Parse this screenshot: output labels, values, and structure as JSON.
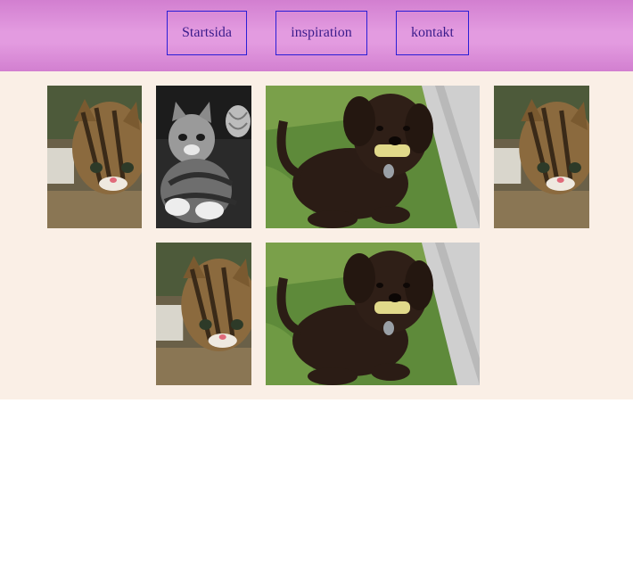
{
  "nav": {
    "items": [
      {
        "label": "Startsida"
      },
      {
        "label": "inspiration"
      },
      {
        "label": "kontakt"
      }
    ]
  },
  "colors": {
    "header_top": "#d27fd0",
    "header_mid": "#e39be0",
    "nav_border": "#2a1fd6",
    "nav_text": "#3b1c8c",
    "gallery_bg": "#faefe6"
  },
  "gallery": {
    "images": [
      {
        "subject": "tabby kitten (color)"
      },
      {
        "subject": "kitten (black and white)"
      },
      {
        "subject": "dark curly dog on grass with toy"
      },
      {
        "subject": "tabby kitten (color)"
      },
      {
        "subject": "tabby kitten (color)"
      },
      {
        "subject": "dark curly dog on grass with toy"
      }
    ]
  }
}
